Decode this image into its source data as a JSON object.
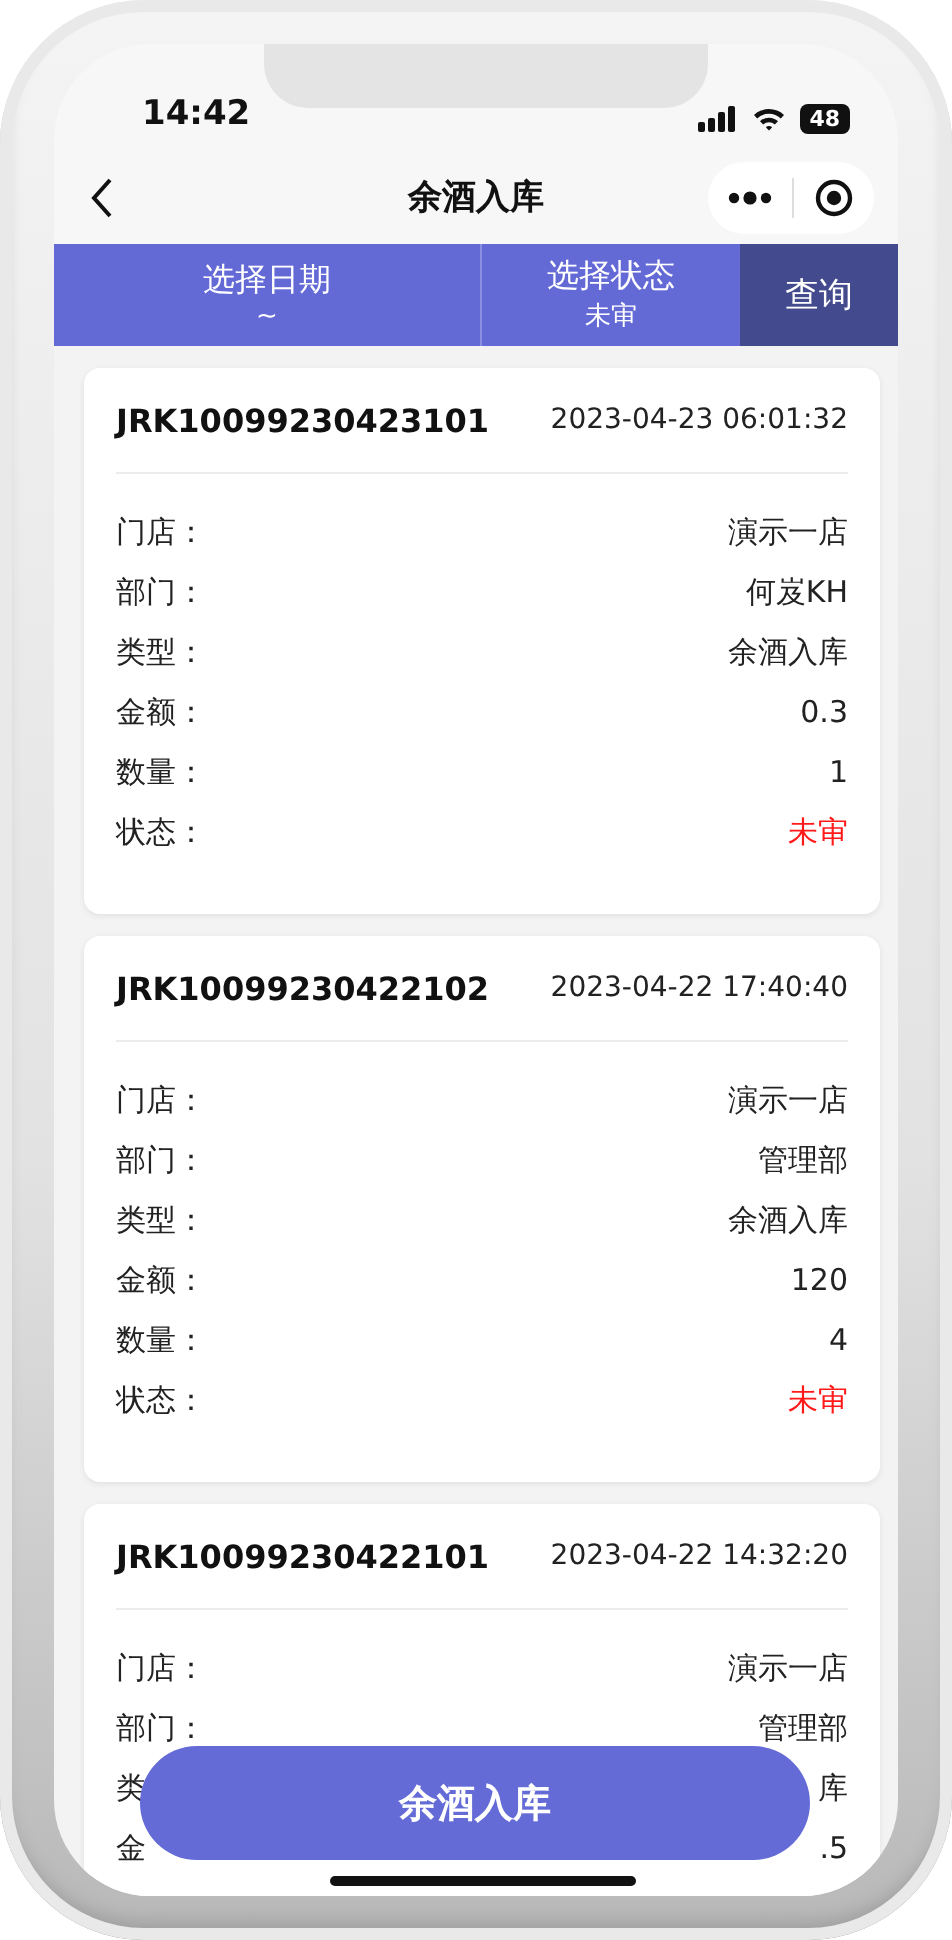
{
  "status_bar": {
    "time": "14:42",
    "battery": "48"
  },
  "nav": {
    "title": "余酒入库"
  },
  "filters": [
    {
      "label": "选择日期",
      "value": "~"
    },
    {
      "label": "选择状态",
      "value": "未审"
    }
  ],
  "query_button": "查询",
  "records": [
    {
      "code": "JRK10099230423101",
      "time": "2023-04-23 06:01:32",
      "fields": [
        {
          "kind": "text",
          "label": "门店：",
          "value": "演示一店"
        },
        {
          "kind": "text",
          "label": "部门：",
          "value": "何岌KH"
        },
        {
          "kind": "text",
          "label": "类型：",
          "value": "余酒入库"
        },
        {
          "kind": "text",
          "label": "金额：",
          "value": "0.3"
        },
        {
          "kind": "text",
          "label": "数量：",
          "value": "1"
        },
        {
          "kind": "status",
          "label": "状态：",
          "value": "未审"
        }
      ]
    },
    {
      "code": "JRK10099230422102",
      "time": "2023-04-22 17:40:40",
      "fields": [
        {
          "kind": "text",
          "label": "门店：",
          "value": "演示一店"
        },
        {
          "kind": "text",
          "label": "部门：",
          "value": "管理部"
        },
        {
          "kind": "text",
          "label": "类型：",
          "value": "余酒入库"
        },
        {
          "kind": "text",
          "label": "金额：",
          "value": "120"
        },
        {
          "kind": "text",
          "label": "数量：",
          "value": "4"
        },
        {
          "kind": "status",
          "label": "状态：",
          "value": "未审"
        }
      ]
    },
    {
      "code": "JRK10099230422101",
      "time": "2023-04-22 14:32:20",
      "fields": [
        {
          "kind": "text",
          "label": "门店：",
          "value": "演示一店"
        },
        {
          "kind": "text",
          "label": "部门：",
          "value": "管理部"
        },
        {
          "kind": "text",
          "label": "类",
          "value": "库"
        },
        {
          "kind": "text",
          "label": "金",
          "value": ".5"
        }
      ]
    }
  ],
  "action_button": "余酒入库"
}
